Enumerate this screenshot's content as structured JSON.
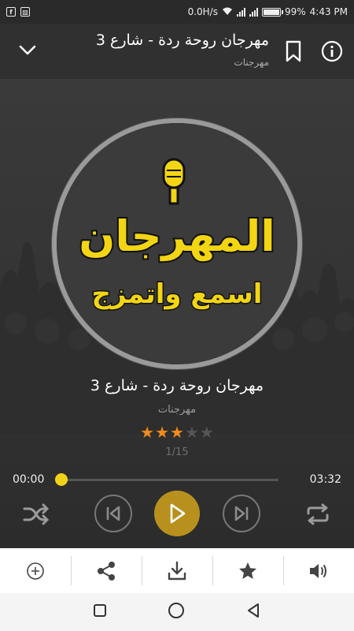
{
  "status_bar": {
    "speed": "0.0H/s",
    "battery": "99%",
    "time": "4:43 PM"
  },
  "header": {
    "title": "مهرجان روحة ردة - شارع 3",
    "subtitle": "مهرجنات"
  },
  "artwork": {
    "logo_title": "المهرجان",
    "logo_subtitle": "اسمع واتمزج"
  },
  "song": {
    "title": "مهرجان روحة ردة - شارع 3",
    "subtitle": "مهرجنات",
    "rating": 3,
    "rating_max": 5,
    "position": "1/15"
  },
  "progress": {
    "elapsed": "00:00",
    "total": "03:32",
    "fraction": 0
  },
  "colors": {
    "accent": "#f0d317",
    "play_button": "#b8901e",
    "star_on": "#f28c1a",
    "star_off": "#555555",
    "header_bg": "#303030"
  },
  "icons": {
    "header": [
      "chevron-down-icon",
      "bookmark-icon",
      "info-icon"
    ],
    "controls": [
      "shuffle-icon",
      "previous-icon",
      "play-icon",
      "next-icon",
      "repeat-icon"
    ],
    "toolbar": [
      "add-icon",
      "share-icon",
      "download-icon",
      "star-icon",
      "volume-icon"
    ],
    "nav": [
      "recent-apps-icon",
      "home-icon",
      "back-icon"
    ]
  }
}
